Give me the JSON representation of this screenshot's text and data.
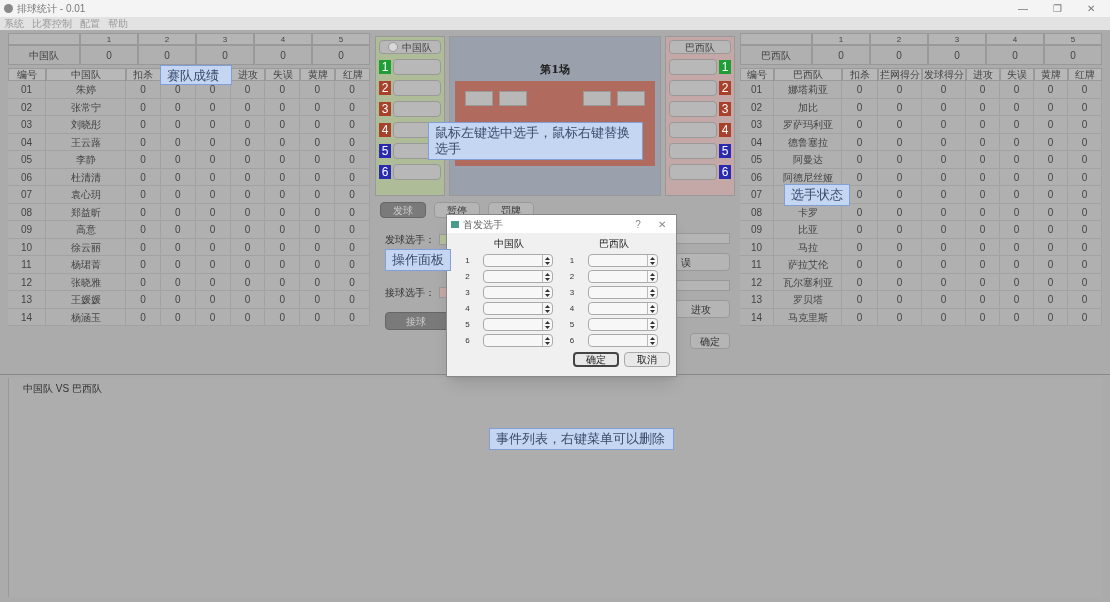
{
  "window": {
    "title": "排球统计 - 0.01",
    "controls": [
      "—",
      "❐",
      "✕"
    ]
  },
  "menu": [
    "系统",
    "比赛控制",
    "配置",
    "帮助"
  ],
  "home_team": {
    "sets_header": [
      "1",
      "2",
      "3",
      "4",
      "5"
    ],
    "team": "中国队",
    "sets": [
      "0",
      "0",
      "0",
      "0",
      "0"
    ],
    "columns": [
      {
        "label": "编号"
      },
      {
        "label": "中国队"
      },
      {
        "label": "扣杀"
      },
      {},
      {},
      {
        "label": "进攻"
      },
      {
        "label": "失误"
      },
      {
        "label": "黄牌"
      },
      {
        "label": "红牌"
      }
    ],
    "players": [
      {
        "number": "01",
        "name": "朱婷",
        "stats": [
          "0",
          "0",
          "0",
          "0",
          "0",
          "0",
          "0"
        ]
      },
      {
        "number": "02",
        "name": "张常宁",
        "stats": [
          "0",
          "0",
          "0",
          "0",
          "0",
          "0",
          "0"
        ]
      },
      {
        "number": "03",
        "name": "刘晓彤",
        "stats": [
          "0",
          "0",
          "0",
          "0",
          "0",
          "0",
          "0"
        ]
      },
      {
        "number": "04",
        "name": "王云蕗",
        "stats": [
          "0",
          "0",
          "0",
          "0",
          "0",
          "0",
          "0"
        ]
      },
      {
        "number": "05",
        "name": "李静",
        "stats": [
          "0",
          "0",
          "0",
          "0",
          "0",
          "0",
          "0"
        ]
      },
      {
        "number": "06",
        "name": "杜清清",
        "stats": [
          "0",
          "0",
          "0",
          "0",
          "0",
          "0",
          "0"
        ]
      },
      {
        "number": "07",
        "name": "袁心玥",
        "stats": [
          "0",
          "0",
          "0",
          "0",
          "0",
          "0",
          "0"
        ]
      },
      {
        "number": "08",
        "name": "郑益昕",
        "stats": [
          "0",
          "0",
          "0",
          "0",
          "0",
          "0",
          "0"
        ]
      },
      {
        "number": "09",
        "name": "高意",
        "stats": [
          "0",
          "0",
          "0",
          "0",
          "0",
          "0",
          "0"
        ]
      },
      {
        "number": "10",
        "name": "徐云丽",
        "stats": [
          "0",
          "0",
          "0",
          "0",
          "0",
          "0",
          "0"
        ]
      },
      {
        "number": "11",
        "name": "杨珺菁",
        "stats": [
          "0",
          "0",
          "0",
          "0",
          "0",
          "0",
          "0"
        ]
      },
      {
        "number": "12",
        "name": "张晓雅",
        "stats": [
          "0",
          "0",
          "0",
          "0",
          "0",
          "0",
          "0"
        ]
      },
      {
        "number": "13",
        "name": "王媛媛",
        "stats": [
          "0",
          "0",
          "0",
          "0",
          "0",
          "0",
          "0"
        ]
      },
      {
        "number": "14",
        "name": "杨涵玉",
        "stats": [
          "0",
          "0",
          "0",
          "0",
          "0",
          "0",
          "0"
        ]
      }
    ],
    "callout": "赛队成绩"
  },
  "away_team": {
    "sets_header": [
      "1",
      "2",
      "3",
      "4",
      "5"
    ],
    "team": "巴西队",
    "sets": [
      "0",
      "0",
      "0",
      "0",
      "0"
    ],
    "columns": [
      {
        "label": "编号"
      },
      {
        "label": "巴西队"
      },
      {
        "label": "扣杀"
      },
      {
        "label": "拦网得分"
      },
      {
        "label": "发球得分"
      },
      {
        "label": "进攻"
      },
      {
        "label": "失误"
      },
      {
        "label": "黄牌"
      },
      {
        "label": "红牌"
      }
    ],
    "players": [
      {
        "number": "01",
        "name": "娜塔莉亚",
        "stats": [
          "0",
          "0",
          "0",
          "0",
          "0",
          "0",
          "0"
        ]
      },
      {
        "number": "02",
        "name": "加比",
        "stats": [
          "0",
          "0",
          "0",
          "0",
          "0",
          "0",
          "0"
        ]
      },
      {
        "number": "03",
        "name": "罗萨玛利亚",
        "stats": [
          "0",
          "0",
          "0",
          "0",
          "0",
          "0",
          "0"
        ]
      },
      {
        "number": "04",
        "name": "德鲁塞拉",
        "stats": [
          "0",
          "0",
          "0",
          "0",
          "0",
          "0",
          "0"
        ]
      },
      {
        "number": "05",
        "name": "阿曼达",
        "stats": [
          "0",
          "0",
          "0",
          "0",
          "0",
          "0",
          "0"
        ]
      },
      {
        "number": "06",
        "name": "阿德尼丝娅",
        "stats": [
          "0",
          "0",
          "0",
          "0",
          "0",
          "0",
          "0"
        ]
      },
      {
        "number": "07",
        "stats": [
          "0",
          "0",
          "0",
          "0",
          "0",
          "0",
          "0"
        ]
      },
      {
        "number": "08",
        "name": "卡罗",
        "stats": [
          "0",
          "0",
          "0",
          "0",
          "0",
          "0",
          "0"
        ]
      },
      {
        "number": "09",
        "name": "比亚",
        "stats": [
          "0",
          "0",
          "0",
          "0",
          "0",
          "0",
          "0"
        ]
      },
      {
        "number": "10",
        "name": "马拉",
        "stats": [
          "0",
          "0",
          "0",
          "0",
          "0",
          "0",
          "0"
        ]
      },
      {
        "number": "11",
        "name": "萨拉艾伦",
        "stats": [
          "0",
          "0",
          "0",
          "0",
          "0",
          "0",
          "0"
        ]
      },
      {
        "number": "12",
        "name": "瓦尔塞利亚",
        "stats": [
          "0",
          "0",
          "0",
          "0",
          "0",
          "0",
          "0"
        ]
      },
      {
        "number": "13",
        "name": "罗贝塔",
        "stats": [
          "0",
          "0",
          "0",
          "0",
          "0",
          "0",
          "0"
        ]
      },
      {
        "number": "14",
        "name": "马克里斯",
        "stats": [
          "0",
          "0",
          "0",
          "0",
          "0",
          "0",
          "0"
        ]
      }
    ],
    "callout": "选手状态"
  },
  "court_panel": {
    "title": "第1场",
    "callout": "鼠标左键选中选手，鼠标右键替换选手",
    "home": {
      "team_button": "中国队",
      "slots": [
        {
          "number": "1",
          "color": "#1f9e35"
        },
        {
          "number": "2",
          "color": "#a8402a"
        },
        {
          "number": "3",
          "color": "#a8402a"
        },
        {
          "number": "4",
          "color": "#a8402a"
        },
        {
          "number": "5",
          "color": "#2a2ab0"
        },
        {
          "number": "6",
          "color": "#2a2ab0"
        }
      ]
    },
    "away": {
      "team_button": "巴西队",
      "slots": [
        {
          "number": "1",
          "color": "#1f9e35"
        },
        {
          "number": "2",
          "color": "#a8402a"
        },
        {
          "number": "3",
          "color": "#a8402a"
        },
        {
          "number": "4",
          "color": "#a8402a"
        },
        {
          "number": "5",
          "color": "#2a2ab0"
        },
        {
          "number": "6",
          "color": "#2a2ab0"
        }
      ]
    }
  },
  "controls": {
    "buttons": [
      {
        "label": "发球",
        "selected": true
      },
      {
        "label": "暂停",
        "selected": false
      },
      {
        "label": "罚牌",
        "selected": false
      }
    ],
    "serve_label": "发球选手：",
    "receive_label": "接球选手：",
    "receive_button": "接球",
    "right_buttons": [
      "误",
      "进攻"
    ],
    "confirm": "确定",
    "callout": "操作面板"
  },
  "dialog": {
    "title": "首发选手",
    "help": "?",
    "close": "✕",
    "columns": [
      {
        "team": "中国队",
        "rows": [
          "1",
          "2",
          "3",
          "4",
          "5",
          "6"
        ]
      },
      {
        "team": "巴西队",
        "rows": [
          "1",
          "2",
          "3",
          "4",
          "5",
          "6"
        ]
      }
    ],
    "buttons": [
      {
        "label": "确定",
        "default": true
      },
      {
        "label": "取消",
        "default": false
      }
    ]
  },
  "events": {
    "items": [
      {
        "label": "中国队 VS 巴西队"
      }
    ],
    "callout": "事件列表，右键菜单可以删除"
  }
}
